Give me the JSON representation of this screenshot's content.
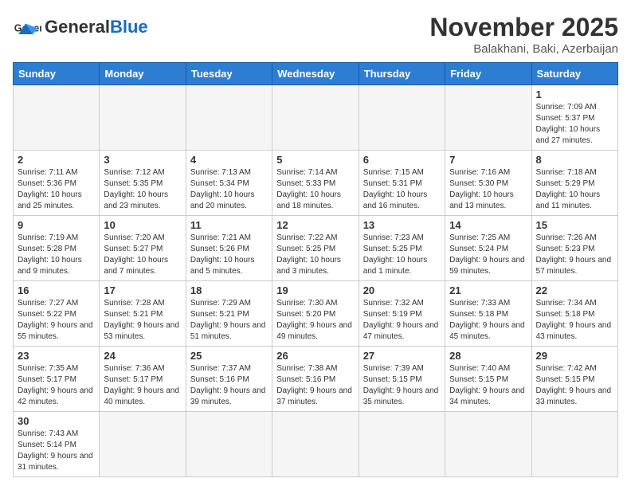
{
  "header": {
    "logo_general": "General",
    "logo_blue": "Blue",
    "month_year": "November 2025",
    "location": "Balakhani, Baki, Azerbaijan"
  },
  "weekdays": [
    "Sunday",
    "Monday",
    "Tuesday",
    "Wednesday",
    "Thursday",
    "Friday",
    "Saturday"
  ],
  "weeks": [
    [
      {
        "day": "",
        "info": ""
      },
      {
        "day": "",
        "info": ""
      },
      {
        "day": "",
        "info": ""
      },
      {
        "day": "",
        "info": ""
      },
      {
        "day": "",
        "info": ""
      },
      {
        "day": "",
        "info": ""
      },
      {
        "day": "1",
        "info": "Sunrise: 7:09 AM\nSunset: 5:37 PM\nDaylight: 10 hours and 27 minutes."
      }
    ],
    [
      {
        "day": "2",
        "info": "Sunrise: 7:11 AM\nSunset: 5:36 PM\nDaylight: 10 hours and 25 minutes."
      },
      {
        "day": "3",
        "info": "Sunrise: 7:12 AM\nSunset: 5:35 PM\nDaylight: 10 hours and 23 minutes."
      },
      {
        "day": "4",
        "info": "Sunrise: 7:13 AM\nSunset: 5:34 PM\nDaylight: 10 hours and 20 minutes."
      },
      {
        "day": "5",
        "info": "Sunrise: 7:14 AM\nSunset: 5:33 PM\nDaylight: 10 hours and 18 minutes."
      },
      {
        "day": "6",
        "info": "Sunrise: 7:15 AM\nSunset: 5:31 PM\nDaylight: 10 hours and 16 minutes."
      },
      {
        "day": "7",
        "info": "Sunrise: 7:16 AM\nSunset: 5:30 PM\nDaylight: 10 hours and 13 minutes."
      },
      {
        "day": "8",
        "info": "Sunrise: 7:18 AM\nSunset: 5:29 PM\nDaylight: 10 hours and 11 minutes."
      }
    ],
    [
      {
        "day": "9",
        "info": "Sunrise: 7:19 AM\nSunset: 5:28 PM\nDaylight: 10 hours and 9 minutes."
      },
      {
        "day": "10",
        "info": "Sunrise: 7:20 AM\nSunset: 5:27 PM\nDaylight: 10 hours and 7 minutes."
      },
      {
        "day": "11",
        "info": "Sunrise: 7:21 AM\nSunset: 5:26 PM\nDaylight: 10 hours and 5 minutes."
      },
      {
        "day": "12",
        "info": "Sunrise: 7:22 AM\nSunset: 5:25 PM\nDaylight: 10 hours and 3 minutes."
      },
      {
        "day": "13",
        "info": "Sunrise: 7:23 AM\nSunset: 5:25 PM\nDaylight: 10 hours and 1 minute."
      },
      {
        "day": "14",
        "info": "Sunrise: 7:25 AM\nSunset: 5:24 PM\nDaylight: 9 hours and 59 minutes."
      },
      {
        "day": "15",
        "info": "Sunrise: 7:26 AM\nSunset: 5:23 PM\nDaylight: 9 hours and 57 minutes."
      }
    ],
    [
      {
        "day": "16",
        "info": "Sunrise: 7:27 AM\nSunset: 5:22 PM\nDaylight: 9 hours and 55 minutes."
      },
      {
        "day": "17",
        "info": "Sunrise: 7:28 AM\nSunset: 5:21 PM\nDaylight: 9 hours and 53 minutes."
      },
      {
        "day": "18",
        "info": "Sunrise: 7:29 AM\nSunset: 5:21 PM\nDaylight: 9 hours and 51 minutes."
      },
      {
        "day": "19",
        "info": "Sunrise: 7:30 AM\nSunset: 5:20 PM\nDaylight: 9 hours and 49 minutes."
      },
      {
        "day": "20",
        "info": "Sunrise: 7:32 AM\nSunset: 5:19 PM\nDaylight: 9 hours and 47 minutes."
      },
      {
        "day": "21",
        "info": "Sunrise: 7:33 AM\nSunset: 5:18 PM\nDaylight: 9 hours and 45 minutes."
      },
      {
        "day": "22",
        "info": "Sunrise: 7:34 AM\nSunset: 5:18 PM\nDaylight: 9 hours and 43 minutes."
      }
    ],
    [
      {
        "day": "23",
        "info": "Sunrise: 7:35 AM\nSunset: 5:17 PM\nDaylight: 9 hours and 42 minutes."
      },
      {
        "day": "24",
        "info": "Sunrise: 7:36 AM\nSunset: 5:17 PM\nDaylight: 9 hours and 40 minutes."
      },
      {
        "day": "25",
        "info": "Sunrise: 7:37 AM\nSunset: 5:16 PM\nDaylight: 9 hours and 39 minutes."
      },
      {
        "day": "26",
        "info": "Sunrise: 7:38 AM\nSunset: 5:16 PM\nDaylight: 9 hours and 37 minutes."
      },
      {
        "day": "27",
        "info": "Sunrise: 7:39 AM\nSunset: 5:15 PM\nDaylight: 9 hours and 35 minutes."
      },
      {
        "day": "28",
        "info": "Sunrise: 7:40 AM\nSunset: 5:15 PM\nDaylight: 9 hours and 34 minutes."
      },
      {
        "day": "29",
        "info": "Sunrise: 7:42 AM\nSunset: 5:15 PM\nDaylight: 9 hours and 33 minutes."
      }
    ],
    [
      {
        "day": "30",
        "info": "Sunrise: 7:43 AM\nSunset: 5:14 PM\nDaylight: 9 hours and 31 minutes."
      },
      {
        "day": "",
        "info": ""
      },
      {
        "day": "",
        "info": ""
      },
      {
        "day": "",
        "info": ""
      },
      {
        "day": "",
        "info": ""
      },
      {
        "day": "",
        "info": ""
      },
      {
        "day": "",
        "info": ""
      }
    ]
  ]
}
